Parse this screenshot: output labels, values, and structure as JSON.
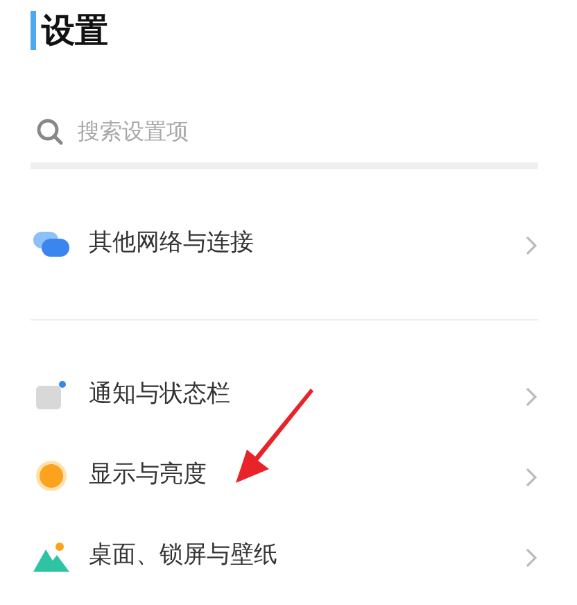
{
  "title": "设置",
  "search": {
    "placeholder": "搜索设置项"
  },
  "groups": [
    {
      "items": [
        {
          "kind": "network",
          "label": "其他网络与连接"
        }
      ]
    },
    {
      "items": [
        {
          "kind": "notification",
          "label": "通知与状态栏"
        },
        {
          "kind": "display",
          "label": "显示与亮度"
        },
        {
          "kind": "wallpaper",
          "label": "桌面、锁屏与壁纸"
        }
      ]
    }
  ]
}
